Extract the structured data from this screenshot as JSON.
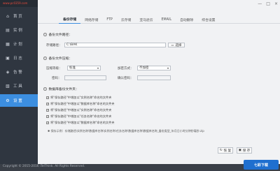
{
  "watermark": "www.pc0359.com",
  "sidebar": {
    "items": [
      {
        "label": "首 页",
        "icon": "home-icon"
      },
      {
        "label": "实 例",
        "icon": "database-icon"
      },
      {
        "label": "计 划",
        "icon": "calendar-icon"
      },
      {
        "label": "日 志",
        "icon": "log-icon"
      },
      {
        "label": "告 警",
        "icon": "bell-icon"
      },
      {
        "label": "工 具",
        "icon": "tool-icon"
      },
      {
        "label": "设 置",
        "icon": "gear-icon"
      }
    ]
  },
  "window_controls": [
    "—",
    "□",
    "×"
  ],
  "tabs": [
    {
      "label": "备份存储",
      "active": true
    },
    {
      "label": "网络存储"
    },
    {
      "label": "FTP"
    },
    {
      "label": "云存储"
    },
    {
      "label": "亚马逊云"
    },
    {
      "label": "EMAIL"
    },
    {
      "label": "自动删除"
    },
    {
      "label": "综合设置"
    }
  ],
  "backup_storage": {
    "section_title": "备份文件路径：",
    "path_label": "存储路径：",
    "path_value": "C:\\BAK",
    "browse_label": "选择"
  },
  "compression": {
    "section_title": "备份文件压缩：",
    "level_label": "压缩等级：",
    "level_value": "标准",
    "method_label": "加密方式：",
    "method_value": "不加密",
    "password_label": "密码：",
    "confirm_label": "确认密码："
  },
  "folder": {
    "section_title": "数据库备份文件夹：",
    "options": [
      "将\"保存路径\"中增加以\"实例名称\"命名的文件夹",
      "将\"保存路径\"中增加以\"数据库名称\"命名的文件夹",
      "将\"保存路径\"中增加以\"实例名称\"命名的文件夹",
      "将\"保存路径\"中增加以\"任务名称\"命名的文件夹",
      "将\"保存路径\"中增加以\"数据库名称\"命名的文件夹"
    ],
    "example": "保存示例：存储路径\\实例名称\\数据库名称\\实例名称\\任务名称\\数据库名称\\数据库名称_备份类型_年月日小时分钟秒毫秒.zip"
  },
  "buttons": {
    "restore_label": "恢 复",
    "save_label": "保 存"
  },
  "copyright": "Copyright © 2015-2016 iTelThink. All Rights Reserved.",
  "brand_badge": "七彩下载"
}
